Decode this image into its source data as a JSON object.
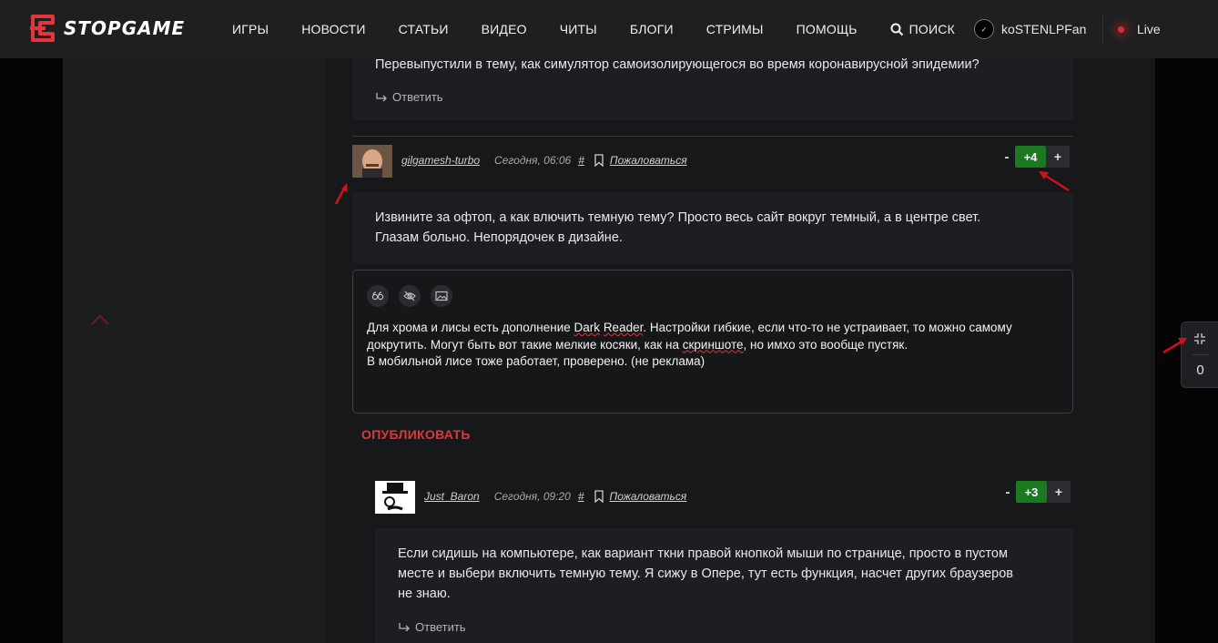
{
  "header": {
    "logo_text": "STOPGAME",
    "nav": [
      "ИГРЫ",
      "НОВОСТИ",
      "СТАТЬИ",
      "ВИДЕО",
      "ЧИТЫ",
      "БЛОГИ",
      "СТРИМЫ",
      "ПОМОЩЬ"
    ],
    "search_label": "ПОИСК",
    "username": "koSTENLPFan",
    "live_label": "Live"
  },
  "comments": {
    "previous": {
      "text": "Перевыпустили в тему, как симулятор самоизолирующегося во время коронавирусной эпидемии?",
      "reply_label": "Ответить"
    },
    "first": {
      "author": "gilgamesh-turbo",
      "time": "Сегодня, 06:06",
      "hash": "#",
      "report_label": "Пожаловаться",
      "rating_minus": "-",
      "rating": "+4",
      "rating_plus": "+",
      "text_line1": "Извините за офтоп, а как влючить темную тему? Просто весь сайт вокруг темный, а в центре свет.",
      "text_line2": "Глазам больно. Непорядочек в дизайне."
    },
    "second": {
      "author": "Just_Baron",
      "time": "Сегодня, 09:20",
      "hash": "#",
      "report_label": "Пожаловаться",
      "rating_minus": "-",
      "rating": "+3",
      "rating_plus": "+",
      "text_line1": "Если сидишь на компьютере, как вариант ткни правой кнопкой мыши по странице, просто в пустом",
      "text_line2": "месте и выбери включить темную тему. Я сижу в Опере, тут есть функция, насчет других браузеров",
      "text_line3": "не знаю.",
      "reply_label": "Ответить"
    }
  },
  "editor": {
    "line1_a": "Для хрома и лисы есть дополнение ",
    "line1_spell1": "Dark",
    "line1_b": " ",
    "line1_spell2": "Reader",
    "line1_c": ". Настройки гибкие, если что-то не устраивает, то можно самому",
    "line2_a": "докрутить. Могут быть вот такие мелкие косяки, как на ",
    "line2_spell": "скриншоте",
    "line2_b": ", но имхо это вообще пустяк.",
    "line3": "В мобильной лисе тоже работает, проверено. (не реклама)",
    "publish_label": "ОПУБЛИКОВАТЬ"
  },
  "widget": {
    "count": "0"
  },
  "colors": {
    "accent": "#e5353a",
    "rating_green": "#1b7a1f",
    "background": "#16181a"
  }
}
